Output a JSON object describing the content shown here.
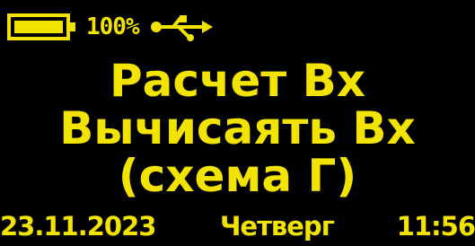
{
  "colors": {
    "background": "#000000",
    "foreground": "#f2e400"
  },
  "status_bar": {
    "battery_icon": "battery-full-icon",
    "battery_percent_text": "100%",
    "battery_level": 1.0,
    "usb_icon": "usb-icon"
  },
  "main": {
    "lines": [
      "Расчет Вх",
      "Вычисаять Вх",
      "(схема Г)"
    ]
  },
  "footer": {
    "date": "23.11.2023",
    "weekday": "Четверг",
    "time": "11:56"
  }
}
